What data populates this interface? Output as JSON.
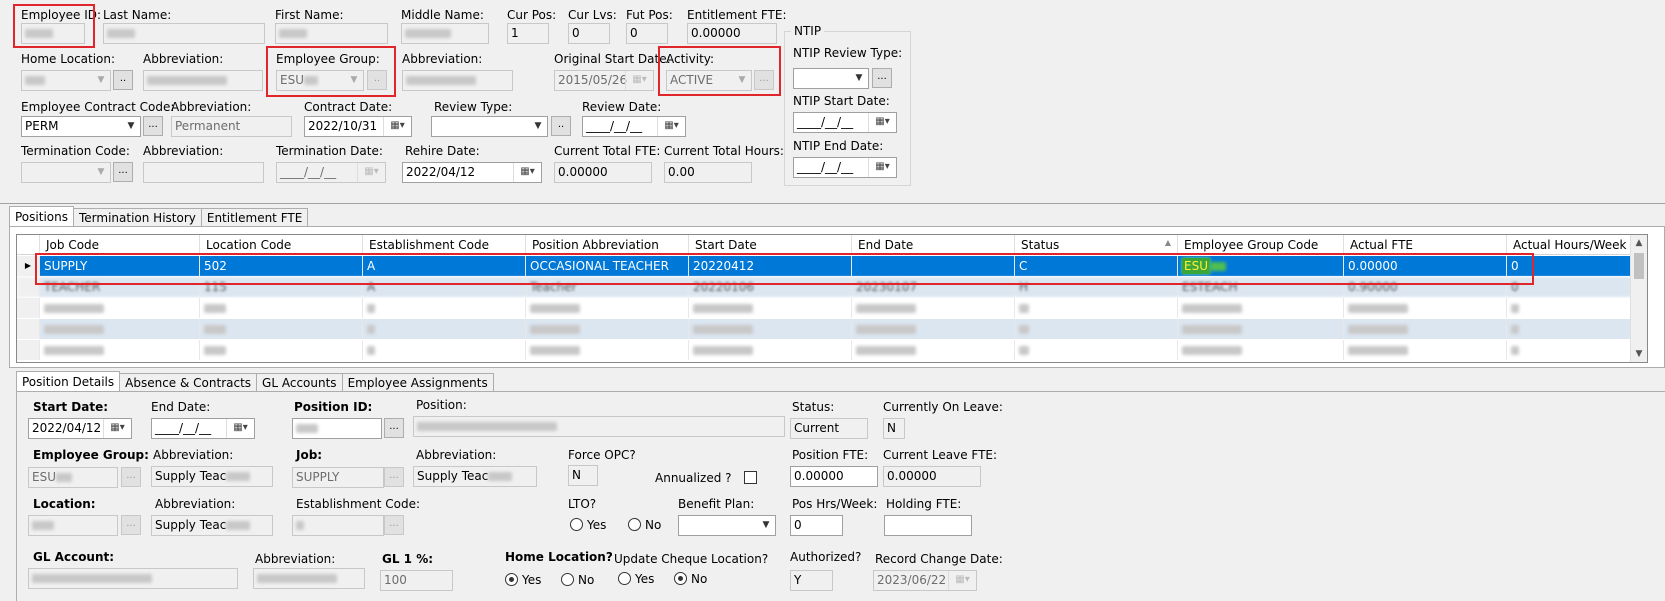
{
  "header": {
    "employee_id": {
      "label": "Employee ID:"
    },
    "last_name": {
      "label": "Last Name:"
    },
    "first_name": {
      "label": "First Name:"
    },
    "middle_name": {
      "label": "Middle Name:"
    },
    "cur_pos": {
      "label": "Cur Pos:",
      "value": "1"
    },
    "cur_lvs": {
      "label": "Cur Lvs:",
      "value": "0"
    },
    "fut_pos": {
      "label": "Fut Pos:",
      "value": "0"
    },
    "entitlement_fte": {
      "label": "Entitlement FTE:",
      "value": "0.00000"
    },
    "home_location": {
      "label": "Home Location:"
    },
    "abbreviation": "Abbreviation:",
    "employee_group": {
      "label": "Employee Group:",
      "value": "ESU"
    },
    "original_start_date": {
      "label": "Original Start Date:",
      "value": "2015/05/26"
    },
    "activity": {
      "label": "Activity:",
      "value": "ACTIVE"
    },
    "contract_code": {
      "label": "Employee Contract Code:",
      "value": "PERM"
    },
    "contract_abbrev": "Permanent",
    "contract_date": {
      "label": "Contract Date:",
      "value": "2022/10/31"
    },
    "review_type": {
      "label": "Review Type:"
    },
    "review_date": {
      "label": "Review Date:",
      "value": "____/__/__"
    },
    "termination_code": {
      "label": "Termination Code:"
    },
    "termination_date": {
      "label": "Termination Date:",
      "value": "____/__/__"
    },
    "rehire_date": {
      "label": "Rehire Date:",
      "value": "2022/04/12"
    },
    "current_total_fte": {
      "label": "Current Total FTE:",
      "value": "0.00000"
    },
    "current_total_hours": {
      "label": "Current Total Hours:",
      "value": "0.00"
    },
    "ntip": {
      "title": "NTIP",
      "review_type": "NTIP Review Type:",
      "start_date": {
        "label": "NTIP Start Date:",
        "value": "____/__/__"
      },
      "end_date": {
        "label": "NTIP End Date:",
        "value": "____/__/__"
      }
    },
    "ellipsis": "...",
    "dots": ".."
  },
  "tabs_top": [
    "Positions",
    "Termination History",
    "Entitlement FTE"
  ],
  "grid": {
    "columns": [
      "Job Code",
      "Location Code",
      "Establishment Code",
      "Position Abbreviation",
      "Start Date",
      "End Date",
      "Status",
      "Employee Group Code",
      "Actual FTE",
      "Actual Hours/Week"
    ],
    "selected_row": [
      "SUPPLY",
      "502",
      "A",
      "OCCASIONAL TEACHER",
      "20220412",
      "",
      "C",
      "ESU",
      "0.00000",
      "0"
    ],
    "row2": [
      "TEACHER",
      "115",
      "A",
      "Teacher",
      "20220106",
      "20230107",
      "H",
      "ESTEACH",
      "0.90000",
      "0"
    ]
  },
  "tabs_bottom": [
    "Position Details",
    "Absence & Contracts",
    "GL Accounts",
    "Employee Assignments"
  ],
  "details": {
    "start_date": {
      "label": "Start Date:",
      "value": "2022/04/12"
    },
    "end_date": {
      "label": "End Date:",
      "value": "____/__/__"
    },
    "position_id": "Position ID:",
    "position": "Position:",
    "status": {
      "label": "Status:",
      "value": "Current"
    },
    "currently_on_leave": {
      "label": "Currently On Leave:",
      "value": "N"
    },
    "employee_group": {
      "label": "Employee Group:",
      "value": "ESU"
    },
    "abbrev_label": "Abbreviation:",
    "abbrev_value": "Supply Teac",
    "job": {
      "label": "Job:",
      "value": "SUPPLY"
    },
    "force_opc": {
      "label": "Force OPC?",
      "value": "N"
    },
    "annualized": "Annualized ?",
    "position_fte": {
      "label": "Position FTE:",
      "value": "0.00000"
    },
    "current_leave_fte": {
      "label": "Current Leave FTE:",
      "value": "0.00000"
    },
    "location": "Location:",
    "establishment_code": "Establishment Code:",
    "lto": "LTO?",
    "yes": "Yes",
    "no": "No",
    "benefit_plan": "Benefit Plan:",
    "pos_hrs_week": {
      "label": "Pos Hrs/Week:",
      "value": "0"
    },
    "holding_fte": "Holding FTE:",
    "gl_account": "GL Account:",
    "gl1": {
      "label": "GL 1 %:",
      "value": "100"
    },
    "home_location": "Home Location?",
    "update_cheque": "Update Cheque Location?",
    "authorized": {
      "label": "Authorized?",
      "value": "Y"
    },
    "record_change_date": {
      "label": "Record Change Date:",
      "value": "2023/06/22"
    }
  },
  "colors": {
    "selection": "#0078d7",
    "highlight": "#e0262a",
    "alt_row": "#dce6f1"
  }
}
